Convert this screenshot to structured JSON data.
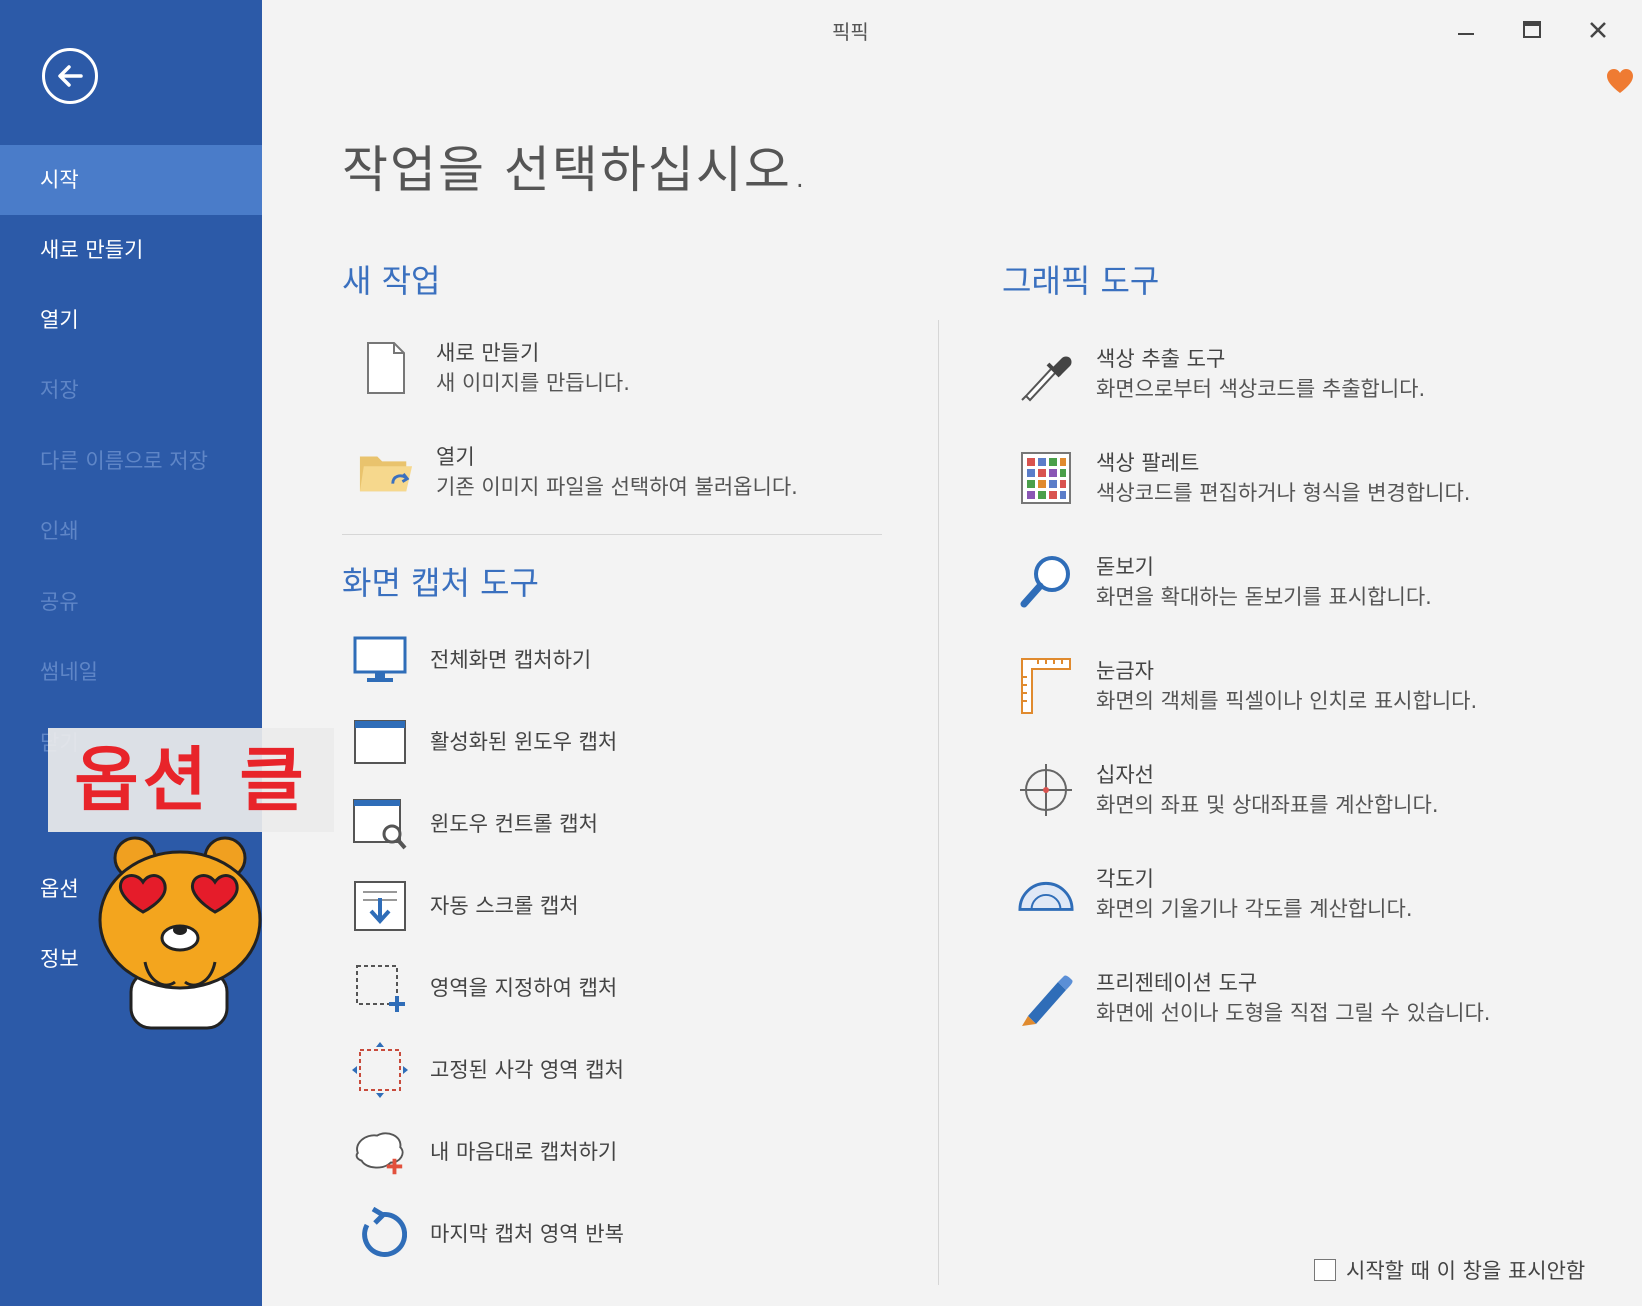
{
  "app": {
    "title": "픽픽"
  },
  "sidebar": {
    "items": [
      {
        "label": "시작",
        "state": "active"
      },
      {
        "label": "새로 만들기",
        "state": "normal"
      },
      {
        "label": "열기",
        "state": "normal"
      },
      {
        "label": "저장",
        "state": "disabled"
      },
      {
        "label": "다른 이름으로 저장",
        "state": "disabled"
      },
      {
        "label": "인쇄",
        "state": "disabled"
      },
      {
        "label": "공유",
        "state": "disabled"
      },
      {
        "label": "썸네일",
        "state": "disabled"
      },
      {
        "label": "닫기",
        "state": "disabled"
      },
      {
        "label": "옵션",
        "state": "normal"
      },
      {
        "label": "정보",
        "state": "normal"
      }
    ]
  },
  "main": {
    "heading": "작업을 선택하십시오.",
    "new_work": {
      "title": "새 작업",
      "items": [
        {
          "label": "새로 만들기",
          "desc": "새 이미지를 만듭니다.",
          "icon": "new-file-icon"
        },
        {
          "label": "열기",
          "desc": "기존 이미지 파일을 선택하여 불러옵니다.",
          "icon": "open-folder-icon"
        }
      ]
    },
    "capture": {
      "title": "화면 캡처 도구",
      "items": [
        {
          "label": "전체화면 캡처하기",
          "icon": "monitor-icon"
        },
        {
          "label": "활성화된 윈도우 캡처",
          "icon": "window-icon"
        },
        {
          "label": "윈도우 컨트롤 캡처",
          "icon": "window-magnifier-icon"
        },
        {
          "label": "자동 스크롤 캡처",
          "icon": "scroll-down-icon"
        },
        {
          "label": "영역을 지정하여 캡처",
          "icon": "region-plus-icon"
        },
        {
          "label": "고정된 사각 영역 캡처",
          "icon": "fixed-region-icon"
        },
        {
          "label": "내 마음대로 캡처하기",
          "icon": "freeform-icon"
        },
        {
          "label": "마지막 캡처 영역 반복",
          "icon": "repeat-icon"
        }
      ]
    },
    "graphic": {
      "title": "그래픽 도구",
      "items": [
        {
          "label": "색상 추출 도구",
          "desc": "화면으로부터 색상코드를 추출합니다.",
          "icon": "eyedropper-icon"
        },
        {
          "label": "색상 팔레트",
          "desc": "색상코드를 편집하거나 형식을 변경합니다.",
          "icon": "palette-icon"
        },
        {
          "label": "돋보기",
          "desc": "화면을 확대하는 돋보기를 표시합니다.",
          "icon": "magnifier-icon"
        },
        {
          "label": "눈금자",
          "desc": "화면의 객체를 픽셀이나 인치로 표시합니다.",
          "icon": "ruler-icon"
        },
        {
          "label": "십자선",
          "desc": "화면의 좌표 및 상대좌표를 계산합니다.",
          "icon": "crosshair-icon"
        },
        {
          "label": "각도기",
          "desc": "화면의 기울기나 각도를 계산합니다.",
          "icon": "protractor-icon"
        },
        {
          "label": "프리젠테이션 도구",
          "desc": "화면에 선이나 도형을 직접 그릴 수 있습니다.",
          "icon": "pen-icon"
        }
      ]
    },
    "footer_checkbox": "시작할 때 이 창을 표시안함"
  },
  "overlay": {
    "annotation": "옵션 클릭"
  },
  "colors": {
    "sidebar": "#2c5aa8",
    "active": "#4a7cc9",
    "accent": "#3a70bf",
    "annotation": "#e8242a"
  }
}
